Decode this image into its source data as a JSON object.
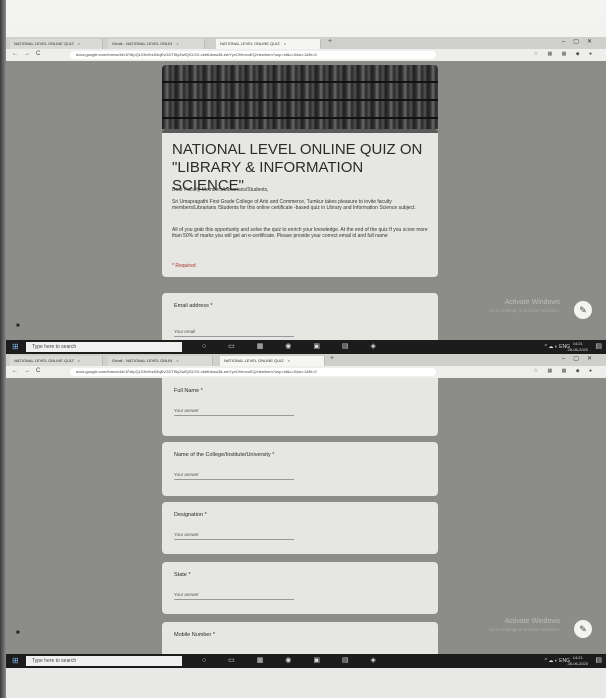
{
  "screen1": {
    "tabs": [
      {
        "label": "NATIONAL LEVEL ONLINE QUIZ",
        "active": false
      },
      {
        "label": "Gmail - NATIONAL LEVEL ONLIN",
        "active": false
      },
      {
        "label": "NATIONAL LEVEL ONLINE QUIZ",
        "active": true
      }
    ],
    "url": "docs.google.com/forms/d/e/1FAIpQLSfxVbzK8qEvGDTt5yZwfQGLSX-vkbfUkwu38-ewYyxOiVmcoEQ/viewform?usp=sf&c=0&w=1&flr=0",
    "form": {
      "title": "NATIONAL LEVEL ONLINE QUIZ ON \"LIBRARY & INFORMATION SCIENCE\"",
      "greeting": "Dear Faculty Members/Librarians/Students,",
      "para1": "Sri Umapragathi First Grade College of Arts and Commerce, Tumkur takes pleasure to invite faculty members/Librarians /Students for this online certificate -based quiz in Library and Information Science subject.",
      "para2": "All of you grab this opportunity and solve the quiz to enrich your knowledge. At the end of the quiz If you score more than 50% of marks you will get an e-certificate. Please provide your correct email id and full name",
      "required": "* Required",
      "email_label": "Email address *",
      "email_placeholder": "Your email"
    },
    "watermark": "Activate Windows",
    "watermark_sub": "Go to Settings to activate Windows."
  },
  "screen2": {
    "tabs": [
      {
        "label": "NATIONAL LEVEL ONLINE QUIZ",
        "active": false
      },
      {
        "label": "Gmail - NATIONAL LEVEL ONLIN",
        "active": false
      },
      {
        "label": "NATIONAL LEVEL ONLINE QUIZ",
        "active": true
      }
    ],
    "url": "docs.google.com/forms/d/e/1FAIpQLSfxVbzK8qEvGDTt5yZwfQGLSX-vkbfUkwu38-ewYyxOiVmcoEQ/viewform?usp=sf&c=0&w=1&flr=0",
    "questions": [
      {
        "label": "Full Name *",
        "hint": "Your answer"
      },
      {
        "label": "Name of the College/Institute/University *",
        "hint": "Your answer"
      },
      {
        "label": "Designation *",
        "hint": "Your answer"
      },
      {
        "label": "State *",
        "hint": "Your answer"
      },
      {
        "label": "Mobile Number *",
        "hint": ""
      }
    ],
    "watermark": "Activate Windows",
    "watermark_sub": "Go to Settings to activate Windows."
  },
  "taskbar": {
    "search_placeholder": "Type here to search",
    "lang": "ENG",
    "time": "14:21",
    "date": "28-06-2020"
  }
}
